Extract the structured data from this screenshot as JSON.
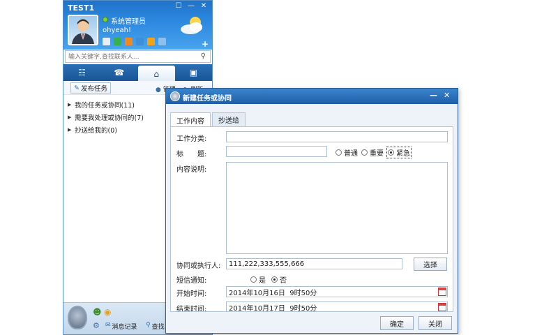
{
  "im": {
    "title": "TEST1",
    "window_controls": [
      "☐",
      "—",
      "✕"
    ],
    "user_name": "系统管理员",
    "signature": "ohyeah!",
    "search_placeholder": "输入关键字,查找联系人...",
    "main_tabs": [
      "☷",
      "☎",
      "⌂",
      "▣"
    ],
    "toolbar": {
      "publish": "发布任务",
      "manage": "管理",
      "refresh": "刷新"
    },
    "tree": [
      {
        "label": "我的任务或协同(11)"
      },
      {
        "label": "需要我处理或协同的(7)"
      },
      {
        "label": "抄送给我的(0)"
      }
    ],
    "footer": {
      "msg_record": "消息记录",
      "find": "查找"
    }
  },
  "dialog": {
    "title": "新建任务或协同",
    "tabs": [
      "工作内容",
      "抄送给"
    ],
    "fields": {
      "category_label": "工作分类:",
      "title_label": "标　　题:",
      "content_label": "内容说明:",
      "assignee_label": "协同或执行人:",
      "assignee_value": "111,222,333,555,666",
      "sms_label": "短信通知:",
      "start_label": "开始时间:",
      "start_value": "2014年10月16日  9时50分",
      "end_label": "结束时间:",
      "end_value": "2014年10月17日  9时50分"
    },
    "priority_options": [
      "普通",
      "重要",
      "紧急"
    ],
    "priority_selected": "紧急",
    "sms_options": [
      "是",
      "否"
    ],
    "sms_selected": "否",
    "select_button": "选择",
    "ok_button": "确定",
    "close_button": "关闭"
  },
  "colors": {
    "accent": "#1f73c9",
    "title_bar": "#1d5fa6"
  }
}
